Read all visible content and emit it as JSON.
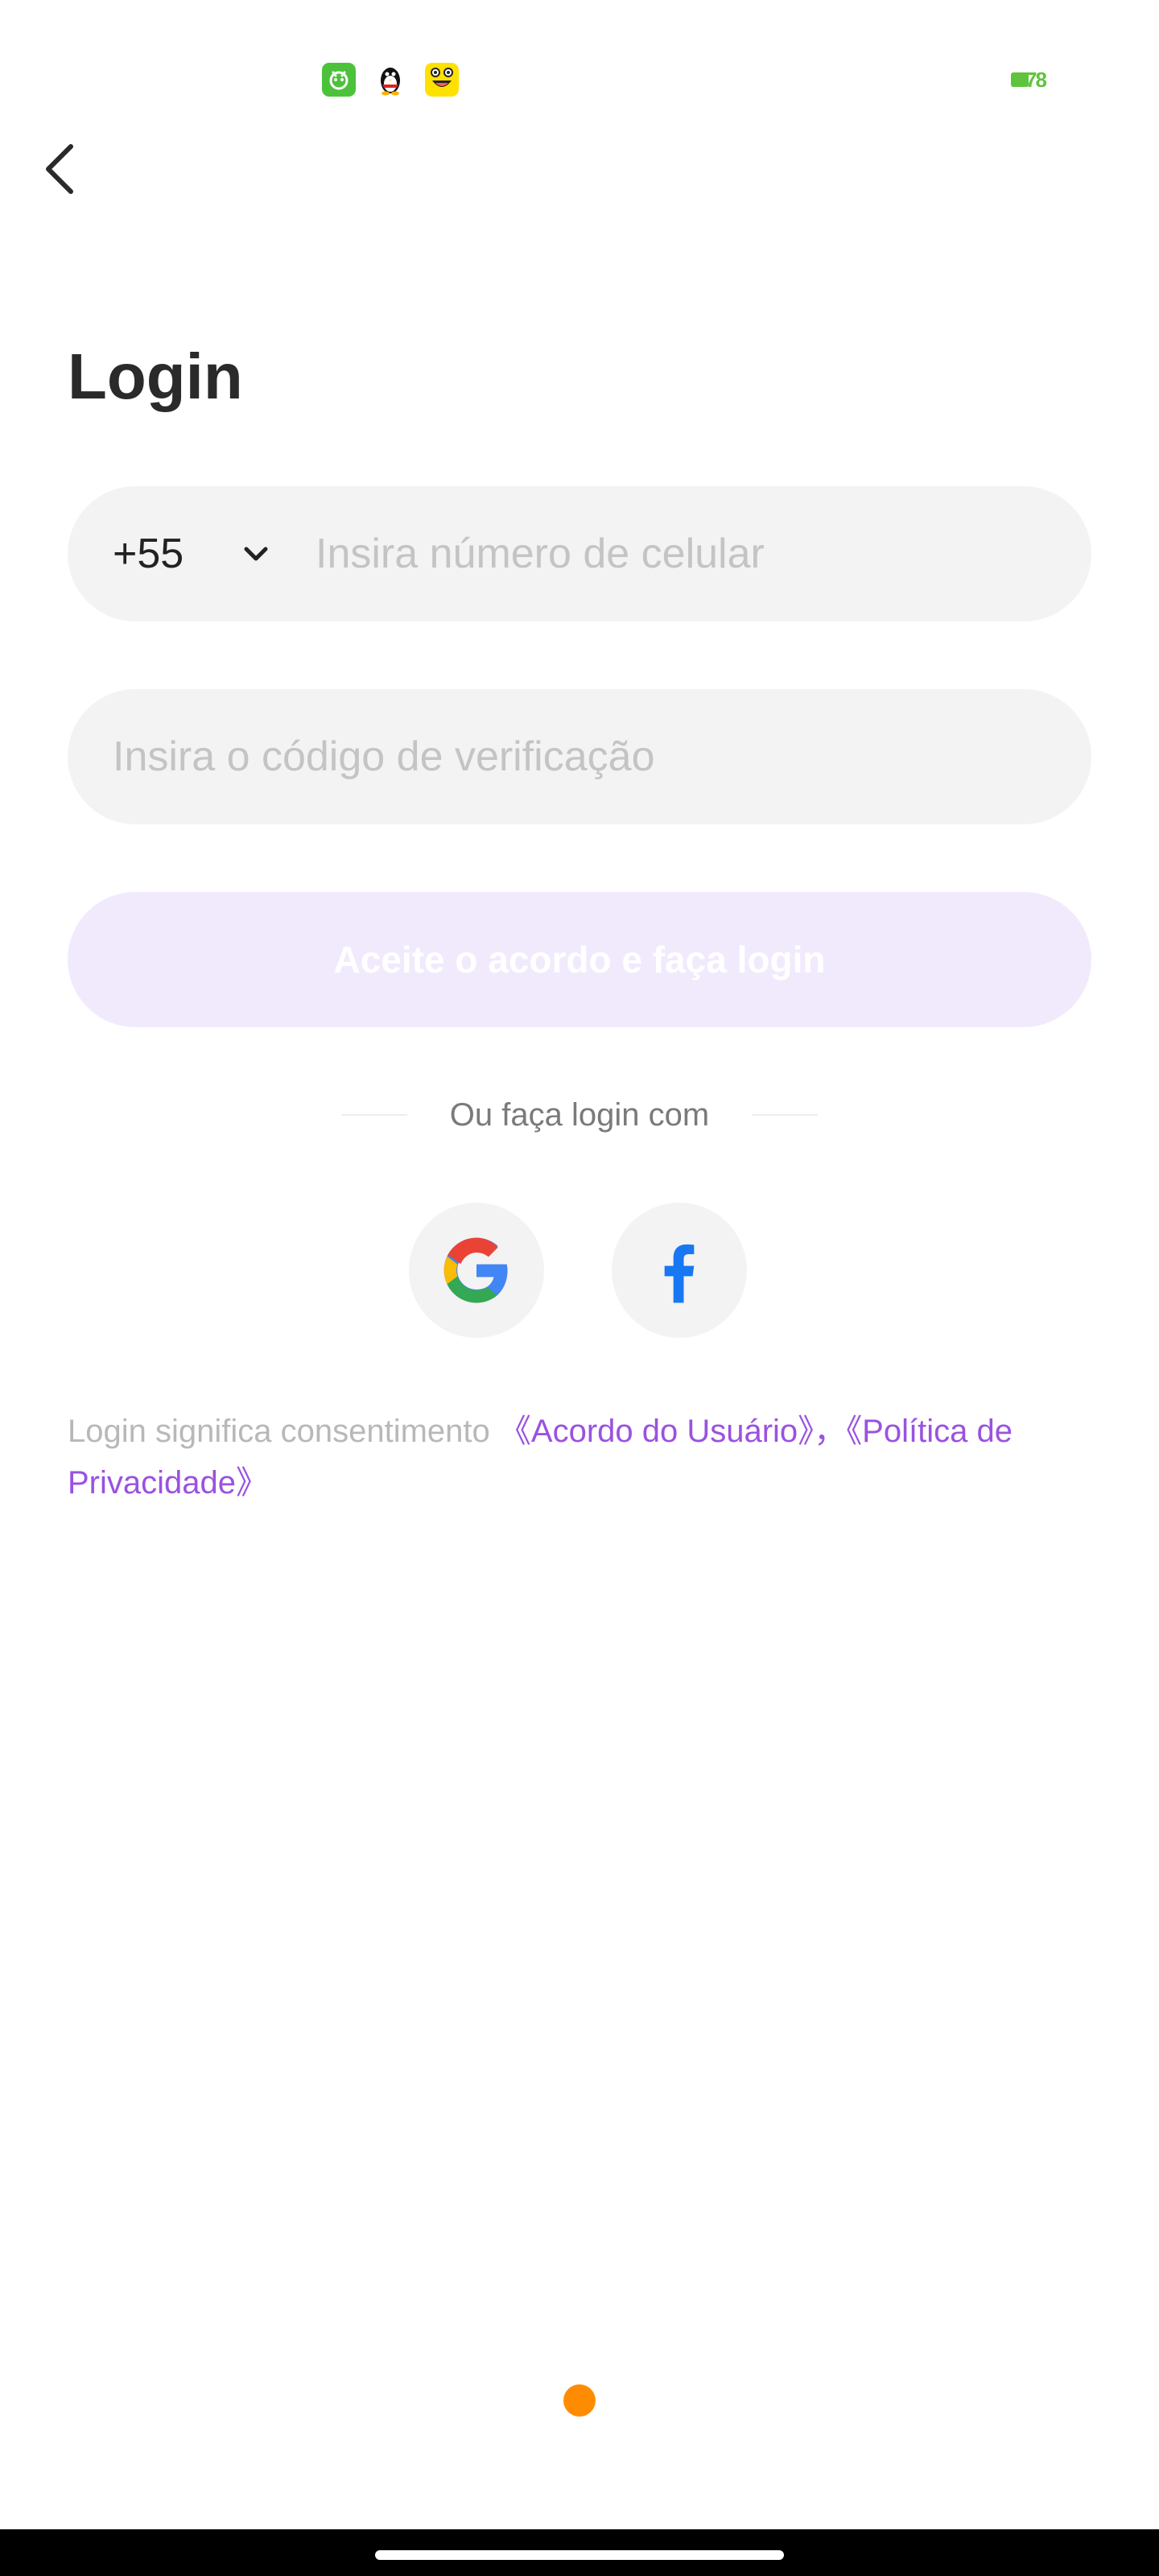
{
  "status_bar": {
    "notification_icons": [
      "app-green-icon",
      "penguin-icon",
      "frog-face-icon"
    ],
    "battery_level": "78",
    "battery_color": "#5ec43d"
  },
  "header": {
    "back_icon": "chevron-left-icon",
    "title": "Login"
  },
  "phone": {
    "country_code": "+55",
    "dropdown_icon": "chevron-down-icon",
    "placeholder": "Insira número de celular",
    "value": ""
  },
  "verification": {
    "placeholder": "Insira o código de verificação",
    "value": ""
  },
  "login_button": {
    "label": "Aceite o acordo e faça login",
    "state": "disabled",
    "color": "#f1eafd"
  },
  "alt_login": {
    "label": "Ou faça login com",
    "providers": [
      {
        "name": "Google",
        "icon": "google-icon"
      },
      {
        "name": "Facebook",
        "icon": "facebook-icon"
      }
    ]
  },
  "consent": {
    "prefix": "Login significa consentimento ",
    "user_agreement": "《Acordo do Usuário》",
    "separator": "，",
    "privacy_policy": "《Política de Privacidade》",
    "link_color": "#9a52e0"
  },
  "floating_dot_color": "#ff8c00"
}
